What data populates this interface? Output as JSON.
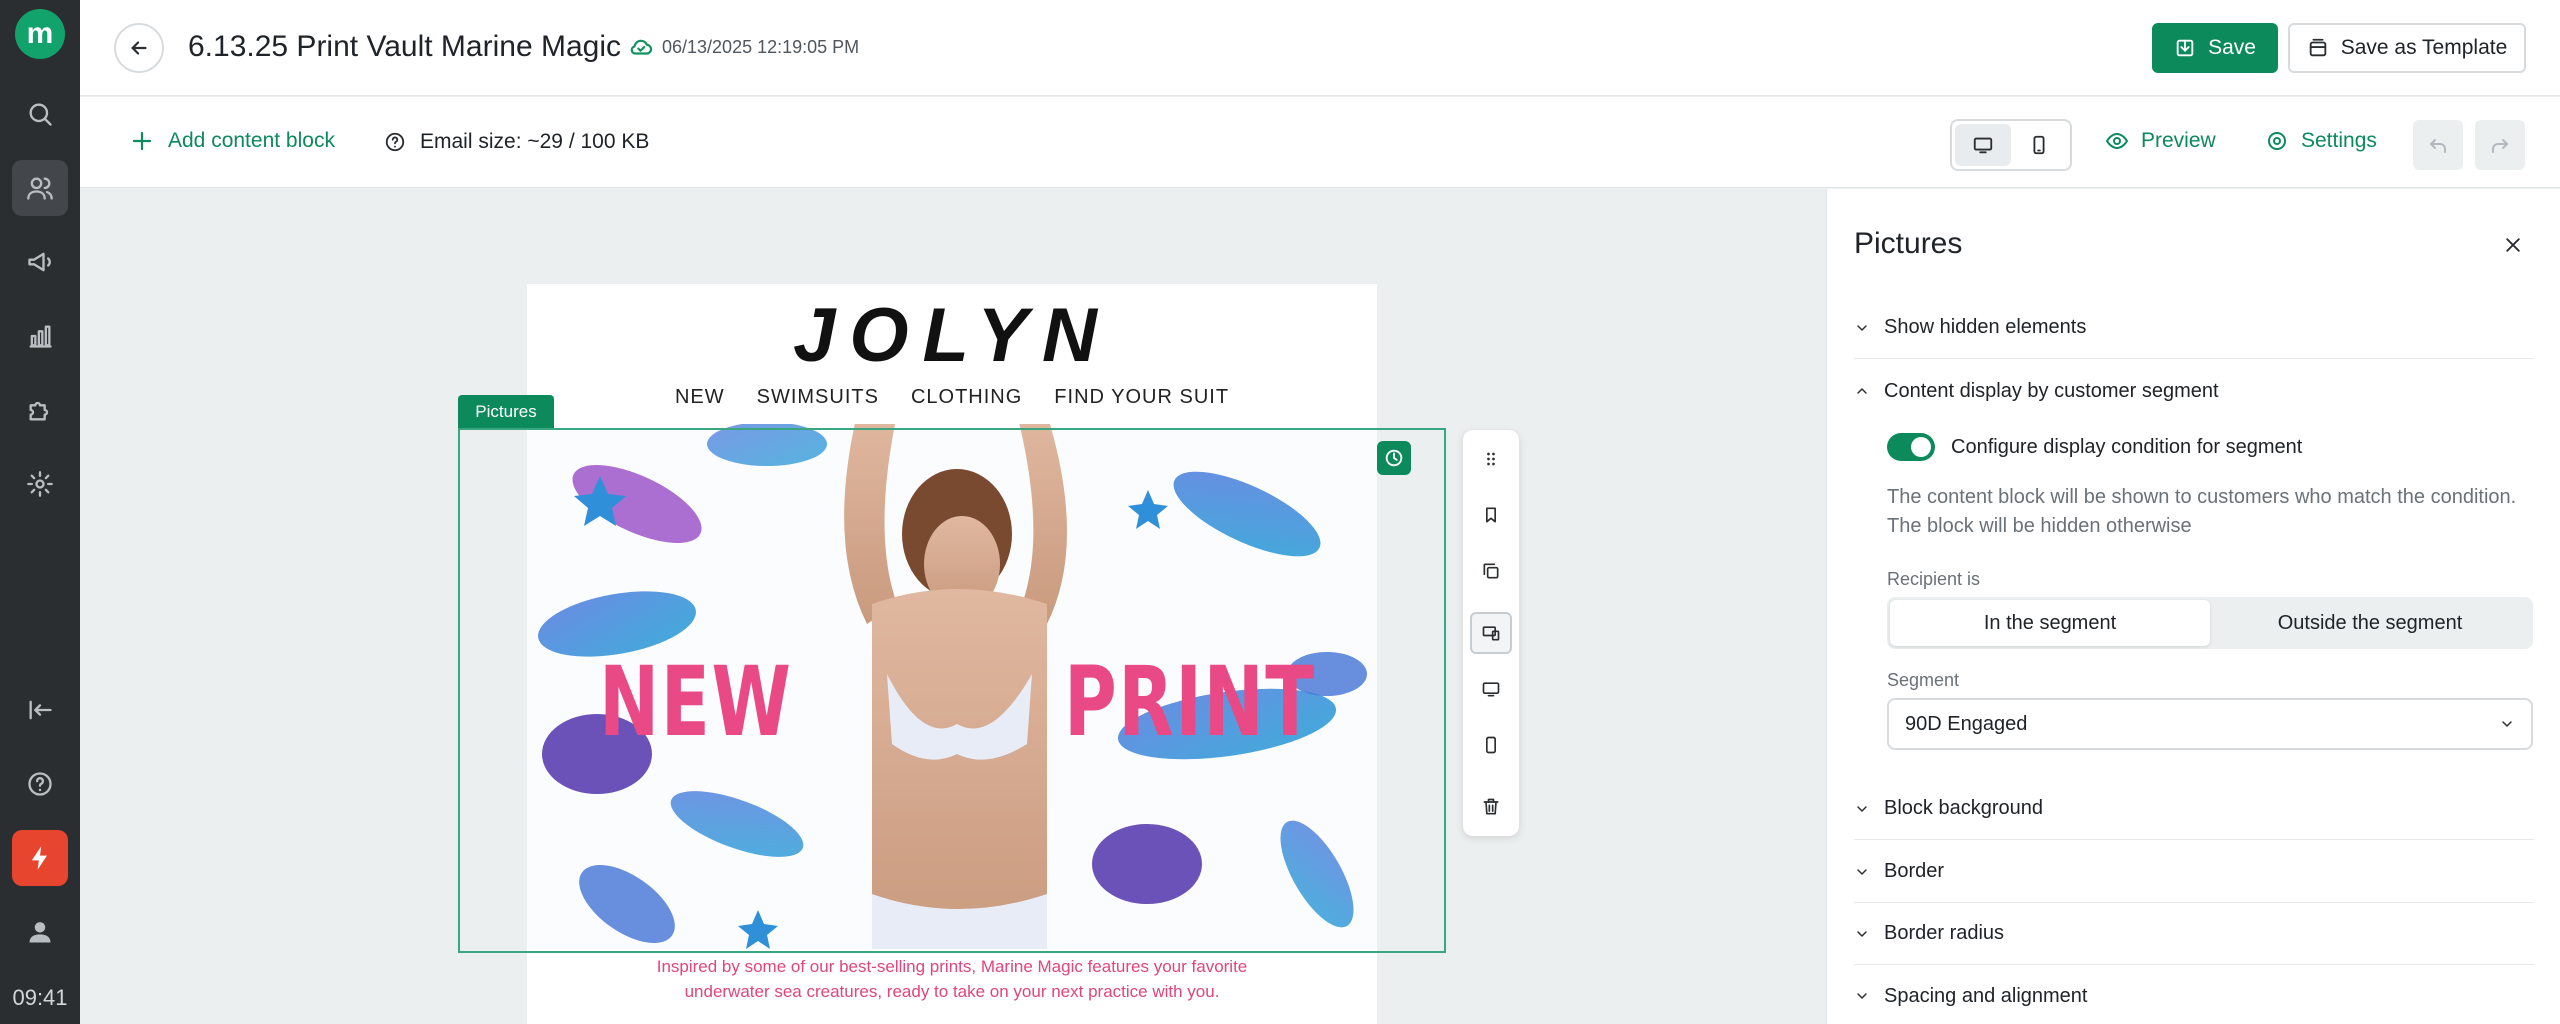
{
  "app": {
    "logo_letter": "m",
    "clock": "09:41"
  },
  "rail": {
    "items": [
      {
        "name": "search-icon"
      },
      {
        "name": "customers-icon"
      },
      {
        "name": "campaigns-icon"
      },
      {
        "name": "analytics-icon"
      },
      {
        "name": "integrations-icon"
      },
      {
        "name": "settings-icon"
      },
      {
        "name": "collapse-icon"
      },
      {
        "name": "help-icon"
      },
      {
        "name": "lightning-icon"
      },
      {
        "name": "profile-icon"
      }
    ]
  },
  "header": {
    "title": "6.13.25 Print Vault Marine Magic",
    "saved_at": "06/13/2025 12:19:05 PM",
    "save_label": "Save",
    "save_template_label": "Save as Template"
  },
  "toolbar": {
    "add_block_label": "Add content block",
    "email_size": "Email size: ~29 / 100 KB",
    "preview_label": "Preview",
    "settings_label": "Settings",
    "active_device": "desktop"
  },
  "email": {
    "brand": "JOLYN",
    "nav": [
      "NEW",
      "SWIMSUITS",
      "CLOTHING",
      "FIND YOUR SUIT"
    ],
    "hero_left": "NEW",
    "hero_right": "PRINT",
    "caption": "Inspired by some of our best-selling prints, Marine Magic features your favorite underwater sea creatures, ready to take on your next practice with you.",
    "block_label": "Pictures"
  },
  "panel": {
    "title": "Pictures",
    "sections": {
      "hidden": "Show hidden elements",
      "segment": "Content display by customer segment",
      "background": "Block background",
      "border": "Border",
      "radius": "Border radius",
      "spacing": "Spacing and alignment"
    },
    "toggle_label": "Configure display condition for segment",
    "toggle_on": true,
    "help_line1": "The content block will be shown to customers who match the condition.",
    "help_line2": "The block will be hidden otherwise",
    "recipient_label": "Recipient is",
    "recipient_options": [
      "In the segment",
      "Outside the segment"
    ],
    "recipient_selected": "In the segment",
    "segment_label": "Segment",
    "segment_value": "90D Engaged"
  },
  "colors": {
    "accent": "#0d8a5c",
    "rail": "#2b2e31",
    "hero_text": "#e94a86",
    "caption": "#e0457c"
  }
}
